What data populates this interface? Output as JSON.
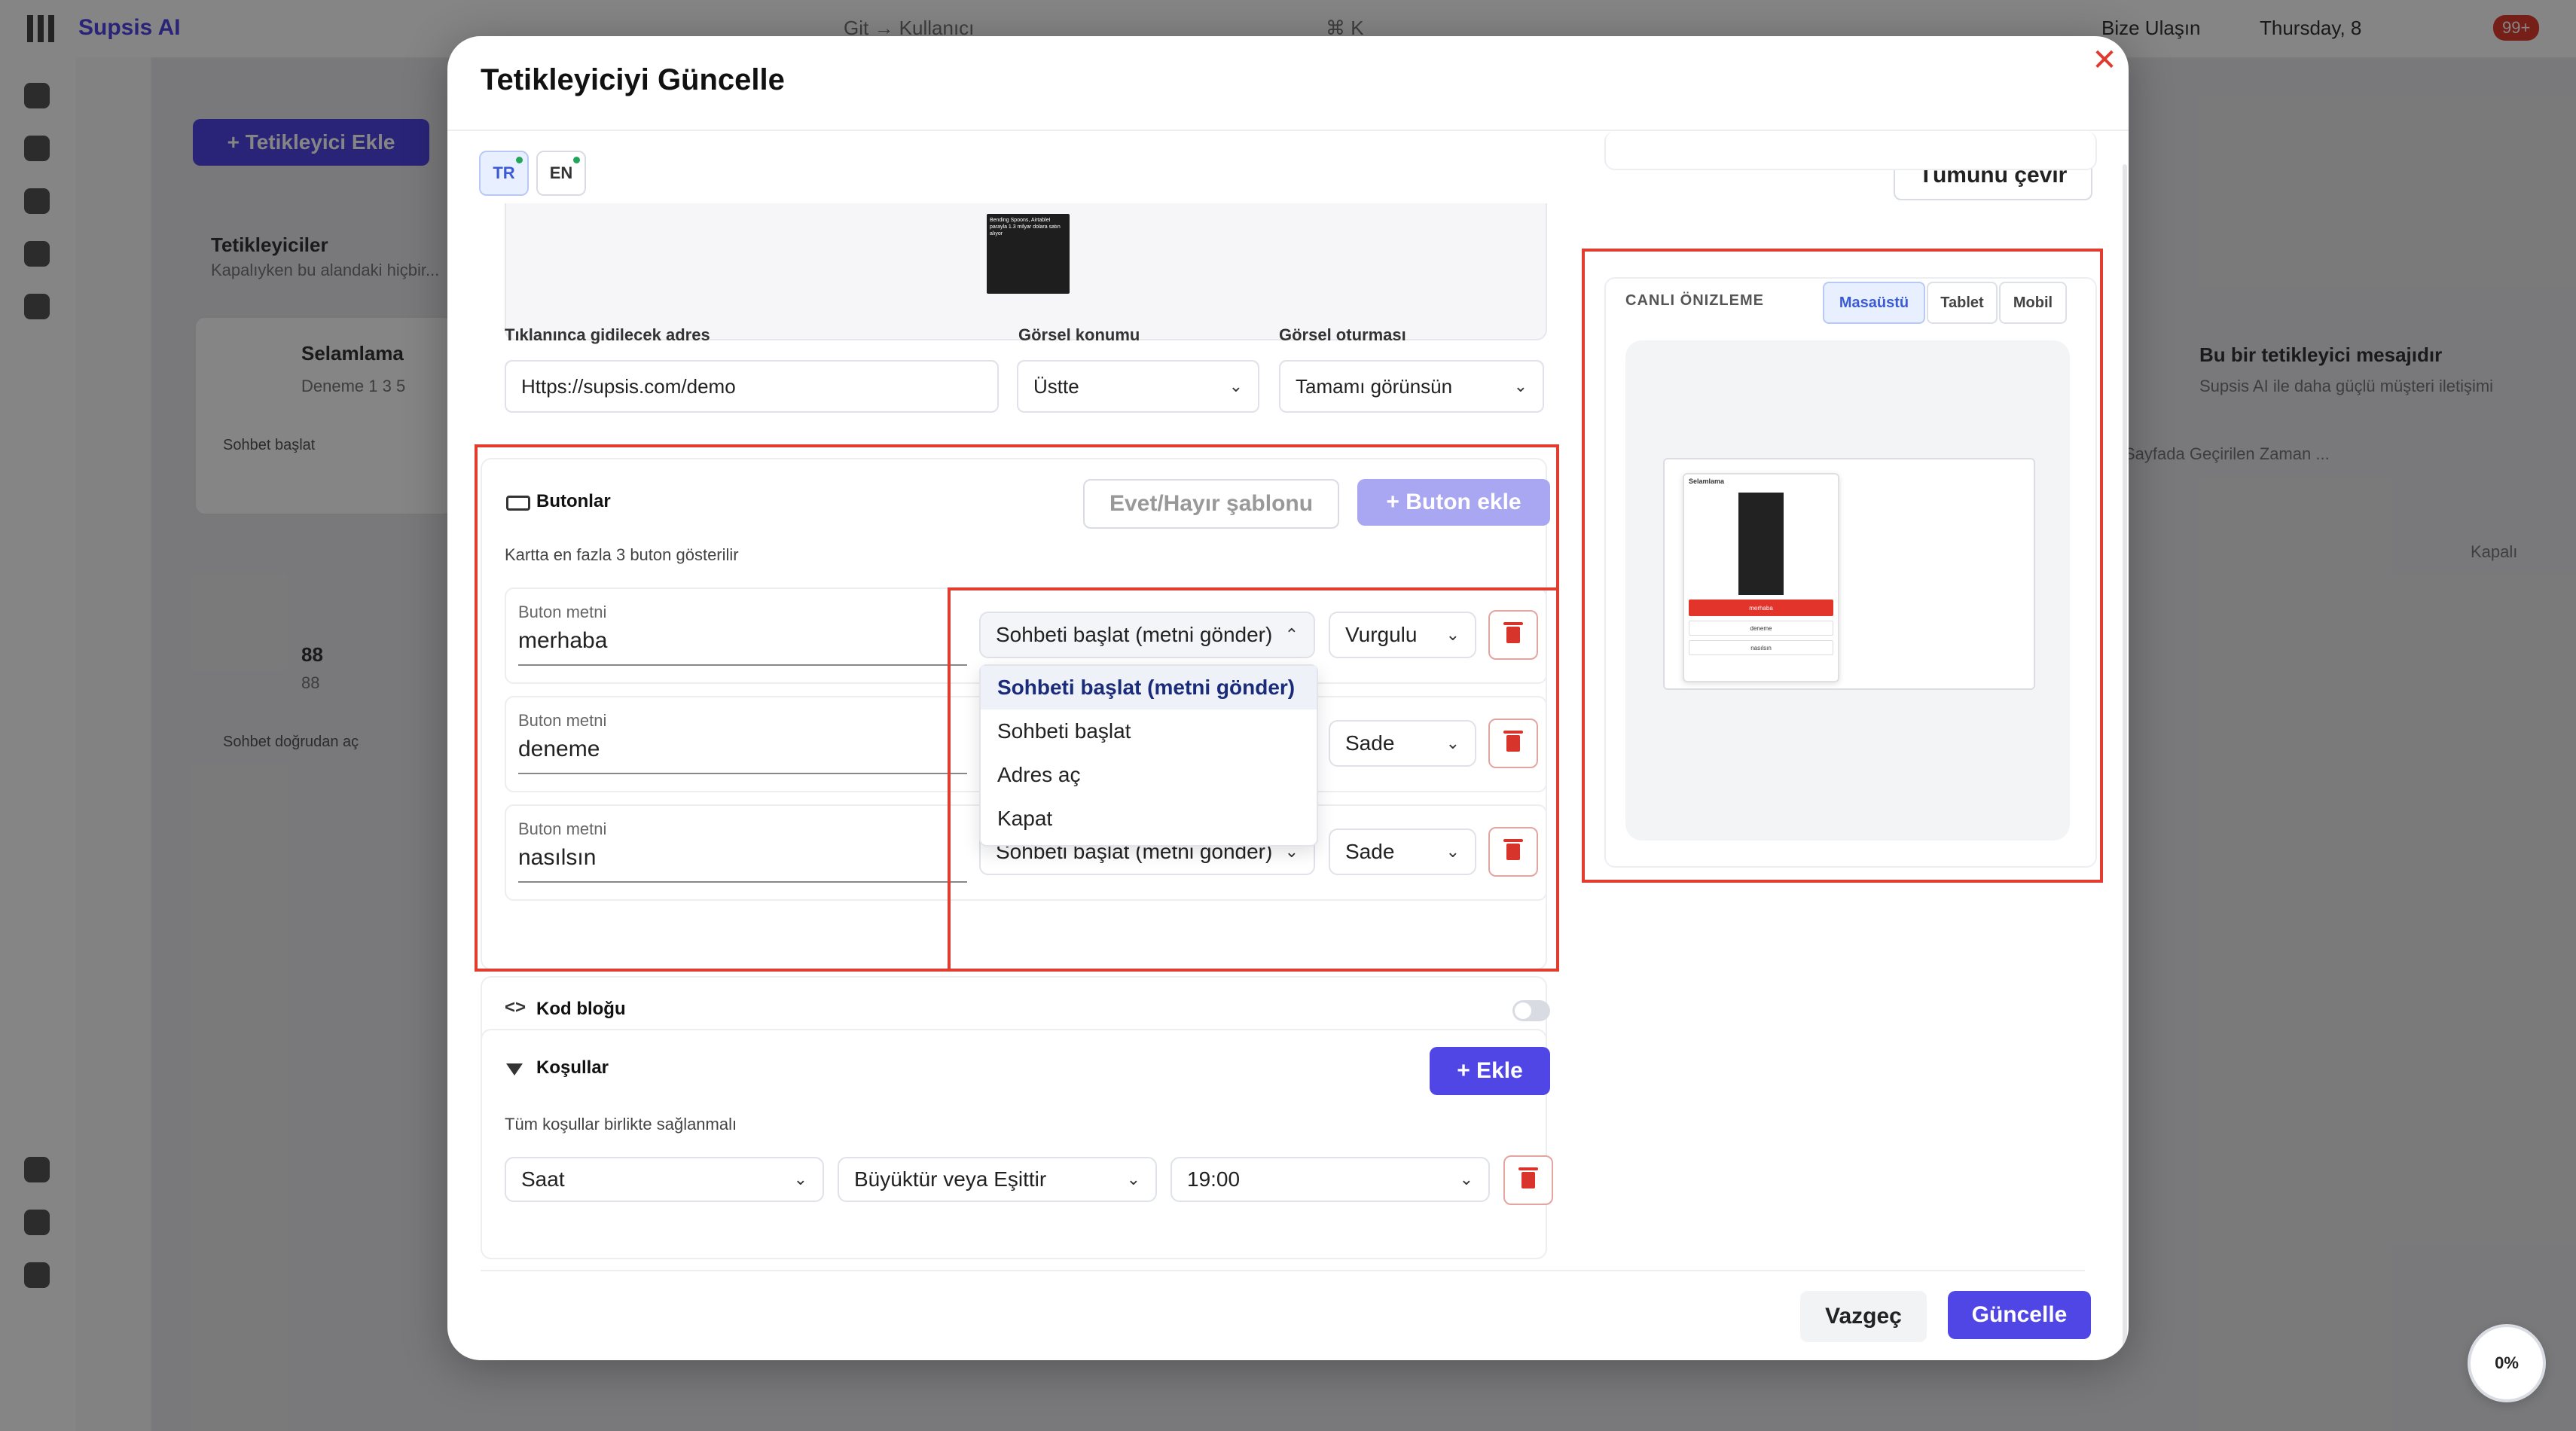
{
  "background": {
    "app_name": "Supsis AI",
    "search_placeholder": "Git → Kullanıcı",
    "search_shortcut": "⌘ K",
    "status_text": "Bize Ulaşın",
    "date_text": "Thursday, 8",
    "badge_count": "99+",
    "add_trigger_button": "+ Tetikleyici Ekle",
    "triggers_title": "Tetikleyiciler",
    "triggers_subtitle": "Kapalıyken bu alandaki hiçbir...",
    "card1_title": "Selamlama",
    "card1_sub": "Deneme 1 3 5",
    "card1_tag": "Sohbet başlat",
    "card2_title": "88",
    "card2_sub": "88",
    "card2_tag": "Sohbet doğrudan aç",
    "right_title": "Bu bir tetikleyici mesajıdır",
    "right_sub": "Supsis AI ile daha güçlü müşteri iletişimi",
    "right_sub2": "Sayfada Geçirilen Zaman ...",
    "right_toggle_label": "Kapalı"
  },
  "modal": {
    "title": "Tetikleyiciyi Güncelle",
    "languages": [
      {
        "code": "TR",
        "active": true
      },
      {
        "code": "EN",
        "active": false
      }
    ],
    "translate_all_button": "Tümünü çevir",
    "image_caption": "Bending Spoons, AirtableI parayla 1.3 milyar dolara satın alıyor",
    "link_label": "Tıklanınca gidilecek adres",
    "link_value": "Https://supsis.com/demo",
    "image_position_label": "Görsel konumu",
    "image_position_value": "Üstte",
    "image_fit_label": "Görsel oturması",
    "image_fit_value": "Tamamı görünsün",
    "buttons_section": {
      "title": "Butonlar",
      "yes_no_template": "Evet/Hayır şablonu",
      "add_button": "+ Buton ekle",
      "hint": "Kartta en fazla 3 buton gösterilir",
      "field_label": "Buton metni",
      "rows": [
        {
          "text": "merhaba",
          "action": "Sohbeti başlat (metni gönder)",
          "style": "Vurgulu"
        },
        {
          "text": "deneme",
          "action": "Sohbeti başlat (metni gönder)",
          "style": "Sade"
        },
        {
          "text": "nasılsın",
          "action": "Sohbeti başlat (metni gönder)",
          "style": "Sade"
        }
      ],
      "action_options": [
        "Sohbeti başlat (metni gönder)",
        "Sohbeti başlat",
        "Adres aç",
        "Kapat"
      ]
    },
    "code_block": {
      "title": "Kod bloğu"
    },
    "conditions": {
      "title": "Koşullar",
      "add_button": "+ Ekle",
      "hint": "Tüm koşullar birlikte sağlanmalı",
      "field": "Saat",
      "operator": "Büyüktür veya Eşittir",
      "value": "19:00"
    },
    "preview": {
      "title": "CANLI ÖNIZLEME",
      "tabs": [
        {
          "label": "Masaüstü",
          "active": true
        },
        {
          "label": "Tablet",
          "active": false
        },
        {
          "label": "Mobil",
          "active": false
        }
      ],
      "card_title": "Selamlama",
      "buttons": [
        "merhaba",
        "deneme",
        "nasılsın"
      ]
    },
    "cancel_button": "Vazgeç",
    "update_button": "Güncelle"
  },
  "progress_badge": "0%",
  "colors": {
    "primary": "#4f46e5",
    "danger": "#d9342b",
    "highlight": "#e13c2e"
  }
}
